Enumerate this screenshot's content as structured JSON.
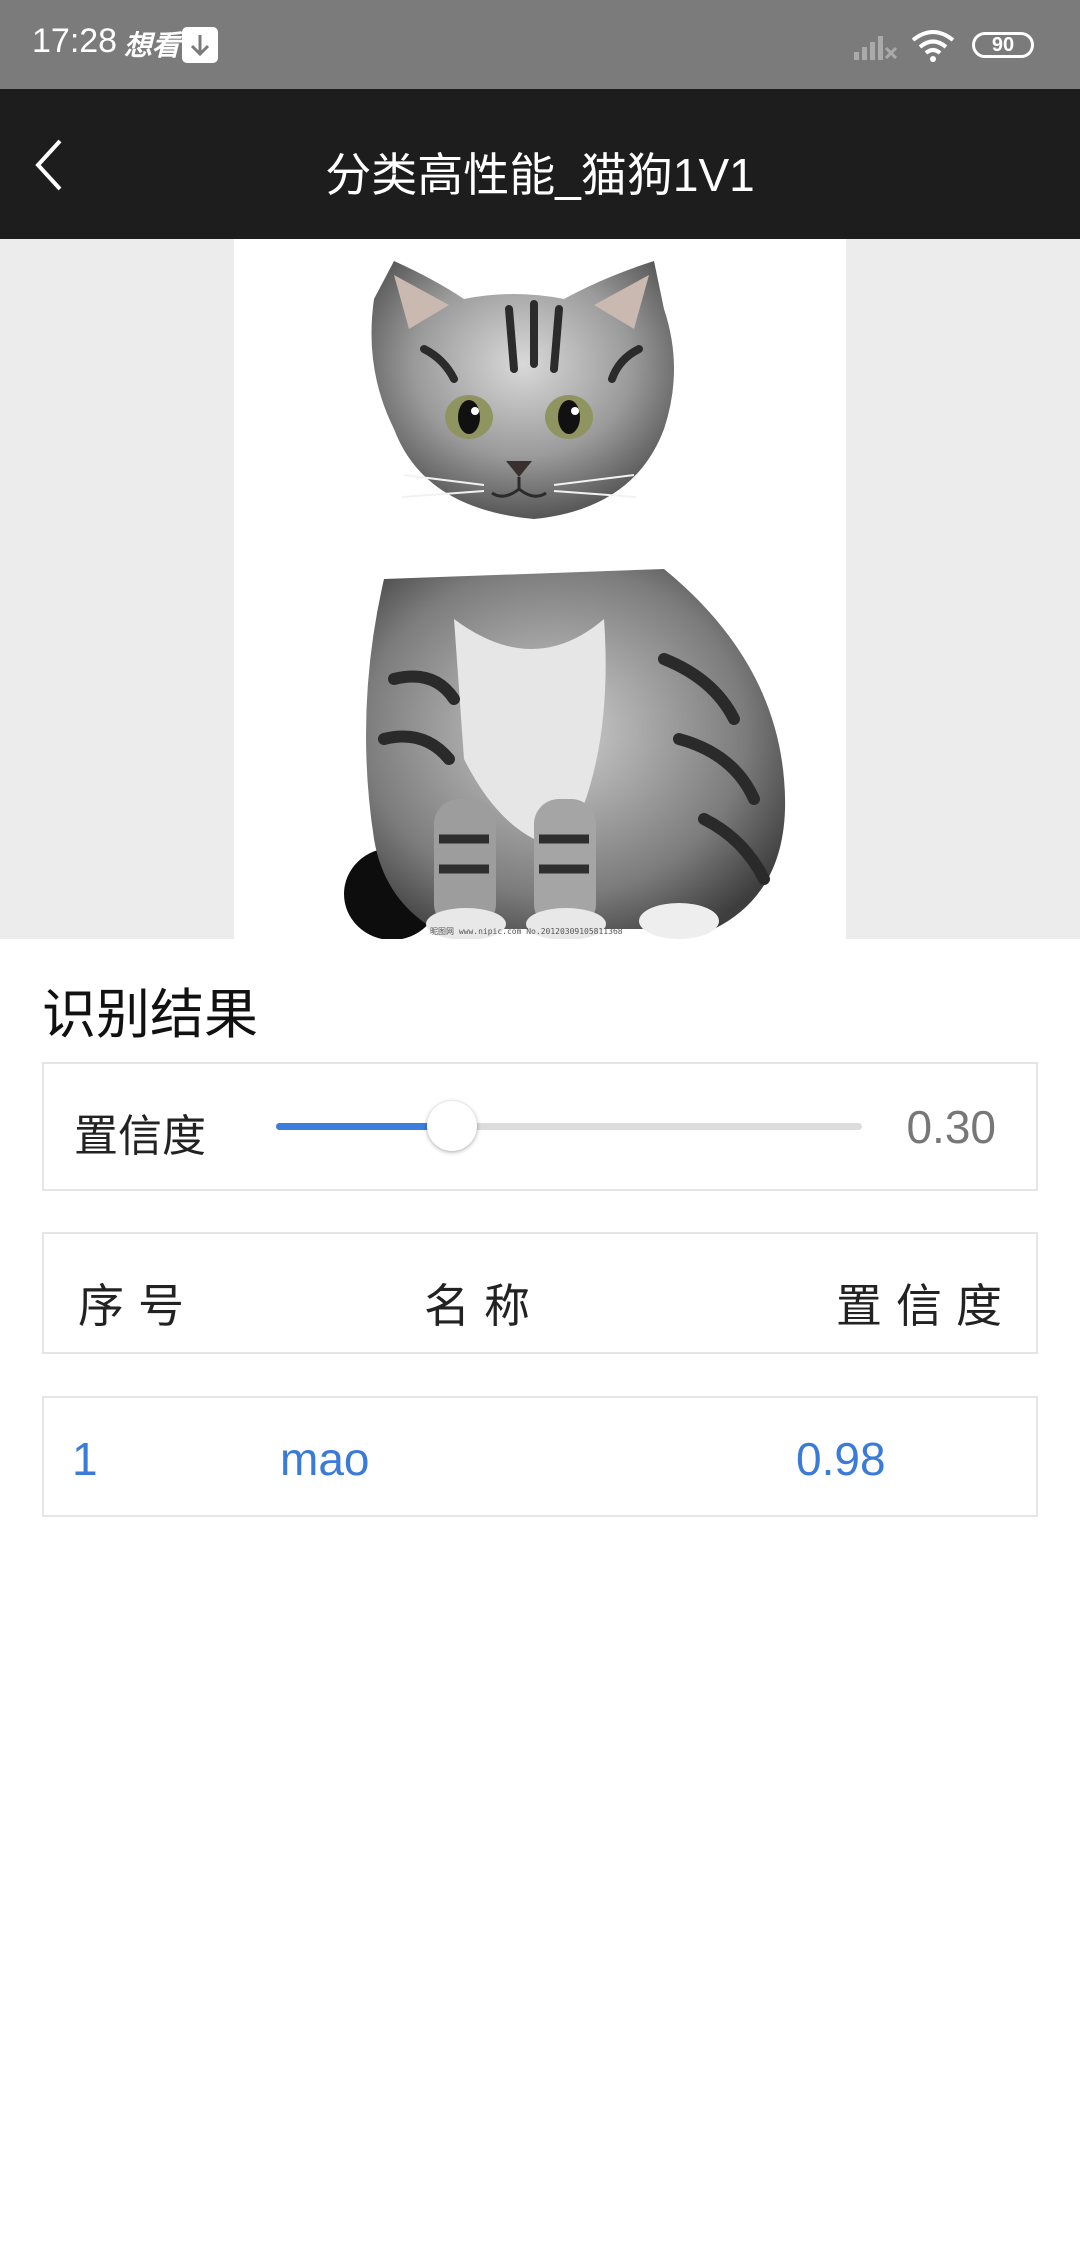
{
  "status_bar": {
    "time": "17:28",
    "app_label": "想看",
    "battery": "90",
    "icons": [
      "download-icon",
      "signal-icon",
      "wifi-icon",
      "battery-icon"
    ]
  },
  "header": {
    "title": "分类高性能_猫狗1V1",
    "back_icon": "chevron-left-icon"
  },
  "image": {
    "subject": "cat",
    "watermark": "昵图网 www.nipic.com  No.20120309105811368"
  },
  "results": {
    "title": "识别结果",
    "confidence": {
      "label": "置信度",
      "value": "0.30",
      "level": 0.3,
      "accent": "#3b7ddd"
    },
    "table": {
      "headers": [
        "序号",
        "名称",
        "置信度"
      ],
      "rows": [
        {
          "index": "1",
          "name": "mao",
          "confidence": "0.98"
        }
      ],
      "row_color": "#3a7ad8"
    }
  }
}
